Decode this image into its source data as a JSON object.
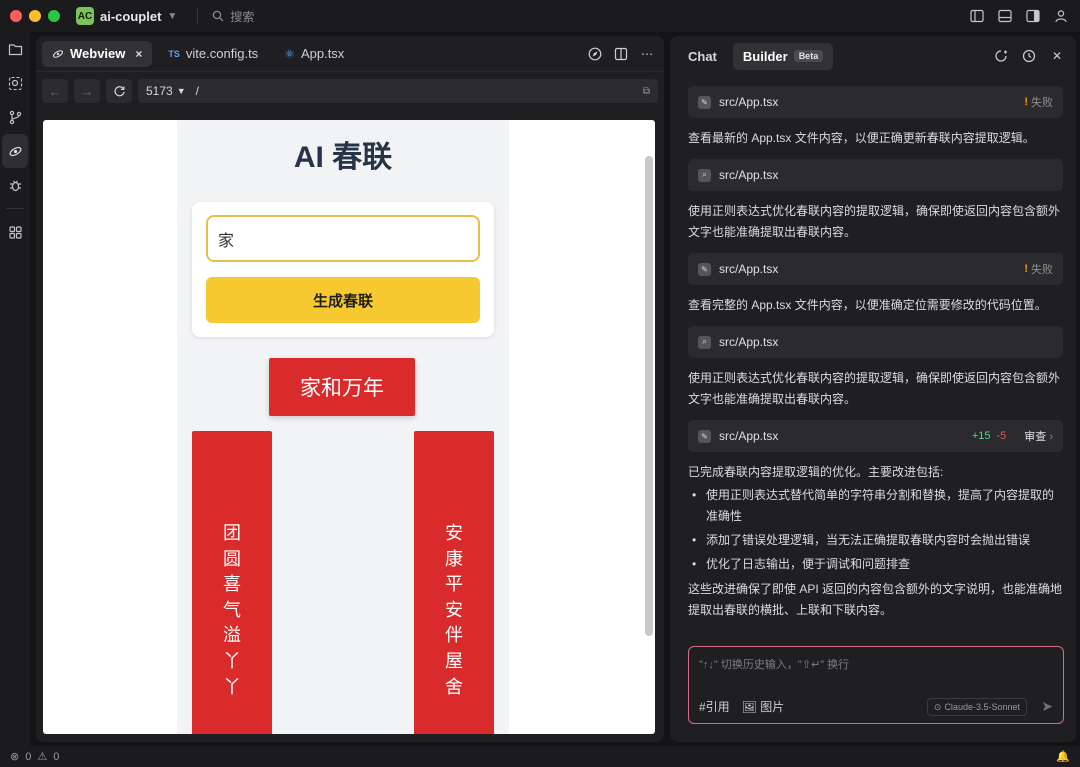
{
  "titlebar": {
    "app_badge": "AC",
    "project": "ai-couplet",
    "search_placeholder": "搜索"
  },
  "tabs": [
    {
      "label": "Webview",
      "close": "×"
    },
    {
      "label": "vite.config.ts",
      "badge": "TS"
    },
    {
      "label": "App.tsx"
    }
  ],
  "urlbar": {
    "port": "5173",
    "path": "/"
  },
  "webpage": {
    "title": "AI 春联",
    "input_value": "家",
    "generate_button": "生成春联",
    "hengpi": "家和万年",
    "left_couplet": [
      "团",
      "圆",
      "喜",
      "气",
      "溢",
      "丫",
      "丫"
    ],
    "right_couplet": [
      "安",
      "康",
      "平",
      "安",
      "伴",
      "屋",
      "舍"
    ]
  },
  "chat": {
    "tab_chat": "Chat",
    "tab_builder": "Builder",
    "beta": "Beta",
    "file1": {
      "name": "src/App.tsx",
      "status": "失败"
    },
    "msg1": "查看最新的 App.tsx 文件内容，以便正确更新春联内容提取逻辑。",
    "file2": {
      "name": "src/App.tsx"
    },
    "msg2": "使用正则表达式优化春联内容的提取逻辑，确保即使返回内容包含额外文字也能准确提取出春联内容。",
    "file3": {
      "name": "src/App.tsx",
      "status": "失败"
    },
    "msg3": "查看完整的 App.tsx 文件内容，以便准确定位需要修改的代码位置。",
    "file4": {
      "name": "src/App.tsx"
    },
    "msg4": "使用正则表达式优化春联内容的提取逻辑，确保即使返回内容包含额外文字也能准确提取出春联内容。",
    "file5": {
      "name": "src/App.tsx",
      "added": "+15",
      "removed": "-5",
      "review": "审查"
    },
    "summary_intro": "已完成春联内容提取逻辑的优化。主要改进包括:",
    "bullets": [
      "使用正则表达式替代简单的字符串分割和替换，提高了内容提取的准确性",
      "添加了错误处理逻辑，当无法正确提取春联内容时会抛出错误",
      "优化了日志输出，便于调试和问题排查"
    ],
    "summary_outro": "这些改进确保了即使 API 返回的内容包含额外的文字说明，也能准确地提取出春联的横批、上联和下联内容。",
    "composer_placeholder": "\"↑↓\" 切换历史输入，\"⇧↵\" 换行",
    "tool_quote": "#引用",
    "tool_image": "图片",
    "model": "Claude-3.5-Sonnet"
  },
  "status": {
    "errors": "0",
    "warnings": "0"
  }
}
